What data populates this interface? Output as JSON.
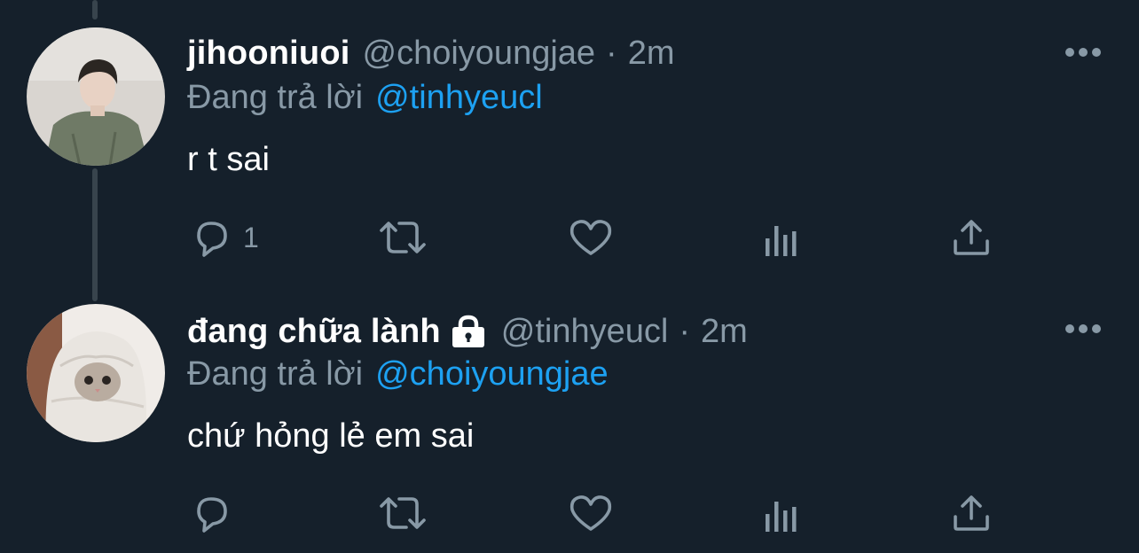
{
  "tweets": [
    {
      "display_name": "jihooniuoi",
      "handle": "@choiyoungjae",
      "separator": "·",
      "time": "2m",
      "reply_prefix": "Đang trả lời",
      "reply_to": "@tinhyeucl",
      "text": "r t sai",
      "reply_count": "1",
      "protected": false
    },
    {
      "display_name": "đang chữa lành",
      "handle": "@tinhyeucl",
      "separator": "·",
      "time": "2m",
      "reply_prefix": "Đang trả lời",
      "reply_to": "@choiyoungjae",
      "text": "chứ hỏng lẻ em sai",
      "reply_count": "",
      "protected": true
    }
  ],
  "icons": {
    "reply": "reply-icon",
    "retweet": "retweet-icon",
    "like": "heart-icon",
    "analytics": "analytics-icon",
    "share": "share-icon",
    "more": "more-icon",
    "lock": "lock-icon"
  },
  "colors": {
    "background": "#15202b",
    "text_primary": "#ffffff",
    "text_secondary": "#8899a6",
    "link": "#1da1f2",
    "thread_line": "#38444d"
  }
}
